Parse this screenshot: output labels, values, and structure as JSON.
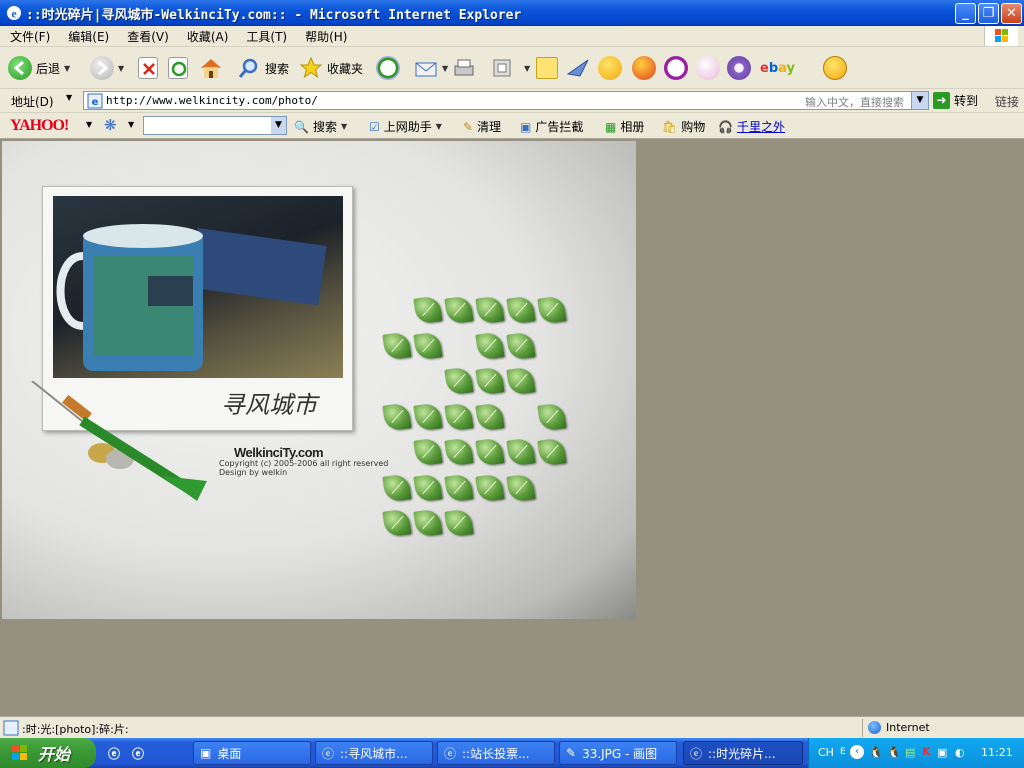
{
  "window": {
    "title": "::时光碎片|寻风城市-WelkinciTy.com:: - Microsoft Internet Explorer"
  },
  "menu": [
    "文件(F)",
    "编辑(E)",
    "查看(V)",
    "收藏(A)",
    "工具(T)",
    "帮助(H)"
  ],
  "toolbar": {
    "back": "后退",
    "search": "搜索",
    "favorites": "收藏夹"
  },
  "address": {
    "label": "地址(D)",
    "url": "http://www.welkincity.com/photo/",
    "hint": "输入中文，直接搜索",
    "go": "转到",
    "links": "链接"
  },
  "yahoo": {
    "logo": "YAHOO!",
    "search": "搜索",
    "assistant": "上网助手",
    "clean": "清理",
    "adblock": "广告拦截",
    "album": "相册",
    "shop": "购物",
    "qianli": "千里之外"
  },
  "page": {
    "signature": "寻风城市",
    "brand": "WelkinciTy.com",
    "copyright": "Copyright (c) 2005-2006 all right reserved",
    "designer": "Design by welkin",
    "leaf_rows": [
      5,
      4,
      3,
      5,
      5,
      5,
      3
    ]
  },
  "status": {
    "text": ":时:光:[photo]:碎:片:",
    "zone": "Internet"
  },
  "taskbar": {
    "start": "开始",
    "tasks": [
      "桌面",
      "::寻风城市...",
      "::站长投票...",
      "33.JPG - 画图",
      "::时光碎片..."
    ],
    "lang": "CH",
    "time": "11:21"
  }
}
